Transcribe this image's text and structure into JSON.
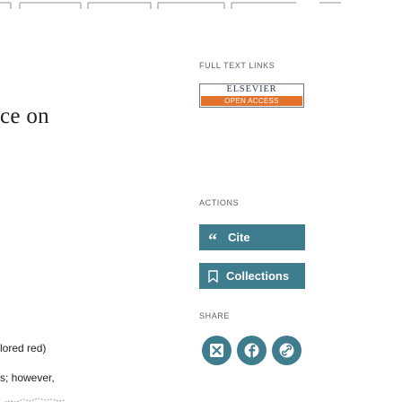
{
  "article": {
    "title_fragment": "ce on",
    "text_line_1": "lored red)",
    "text_line_2": "s; however,"
  },
  "full_text_links": {
    "heading": "FULL TEXT LINKS",
    "publisher_logo": "ELSEVIER",
    "access_badge": "OPEN ACCESS"
  },
  "actions": {
    "heading": "ACTIONS",
    "cite_icon": "“",
    "cite_label": "Cite",
    "collections_label": "Collections"
  },
  "share": {
    "heading": "SHARE",
    "buttons": [
      "twitter-x-icon",
      "facebook-icon",
      "permalink-icon"
    ]
  },
  "colors": {
    "accent": "#3e7c8e",
    "oa_orange": "#e4722b",
    "text": "#212121",
    "muted": "#5b616b"
  }
}
